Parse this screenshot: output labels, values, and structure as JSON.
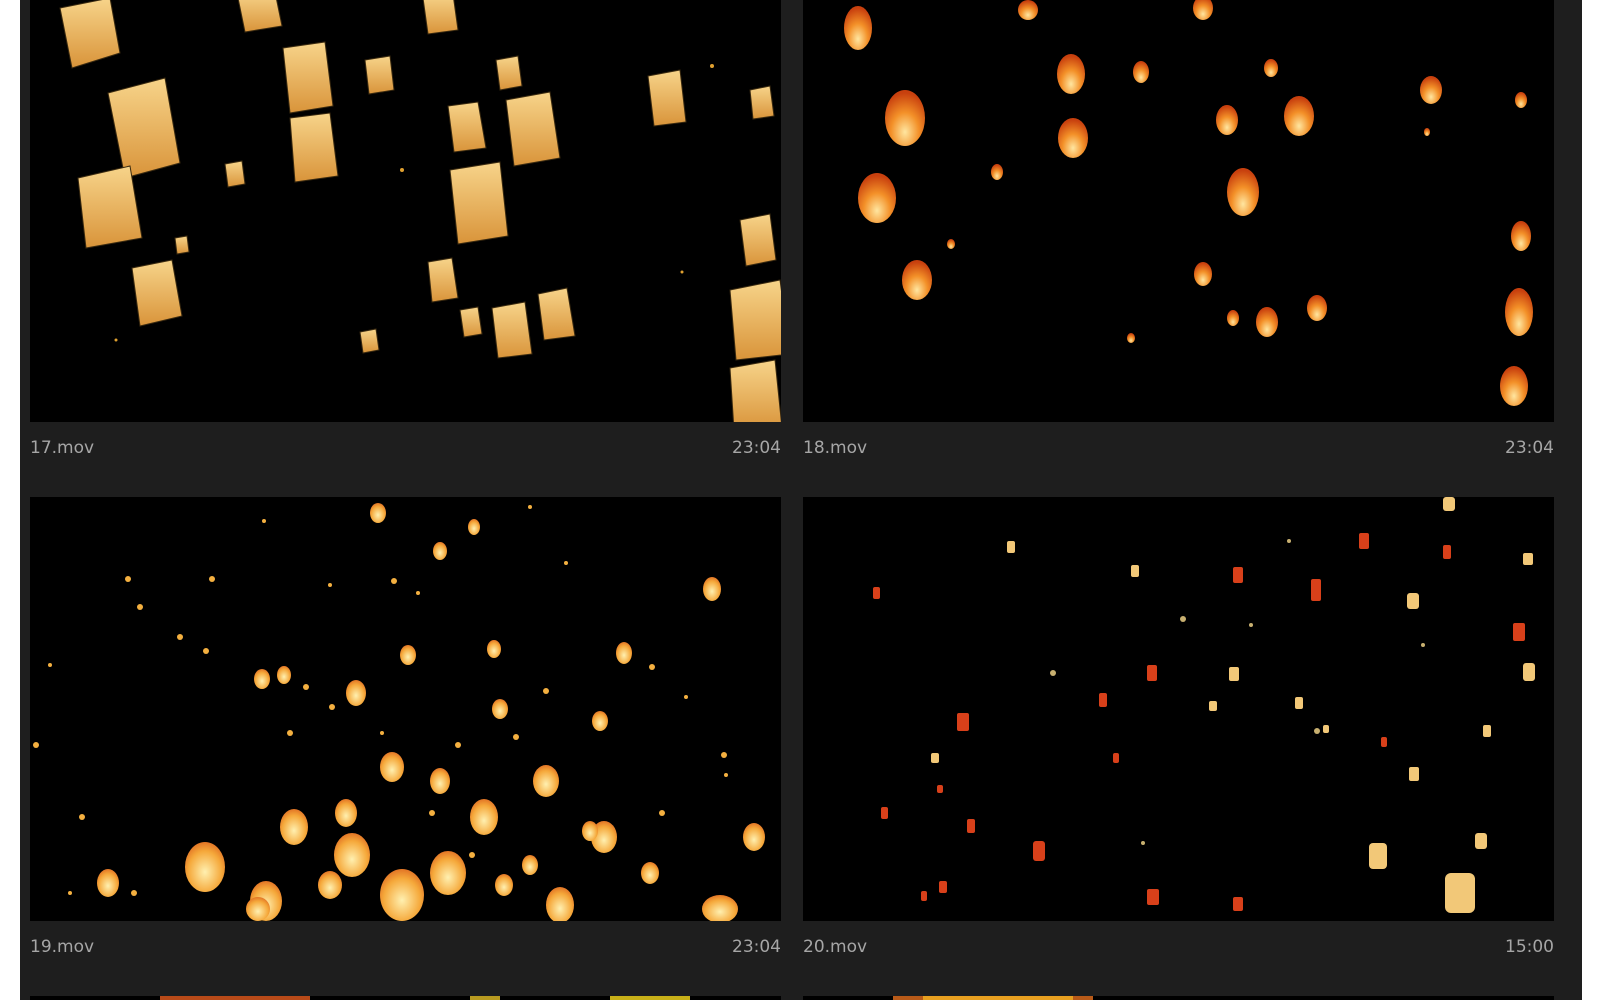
{
  "clips": [
    {
      "name": "17.mov",
      "duration": "23:04",
      "style": "paper-lanterns"
    },
    {
      "name": "18.mov",
      "duration": "23:04",
      "style": "orange-balloons"
    },
    {
      "name": "19.mov",
      "duration": "23:04",
      "style": "dense-lanterns"
    },
    {
      "name": "20.mov",
      "duration": "15:00",
      "style": "sparse-lanterns"
    }
  ],
  "colors": {
    "panel": "#1e1e1e",
    "thumb_bg": "#000000",
    "label": "#a6a6a6",
    "lantern_paper": "#f2c46a",
    "lantern_orange": "#f07a1e",
    "lantern_red": "#d8321a"
  }
}
